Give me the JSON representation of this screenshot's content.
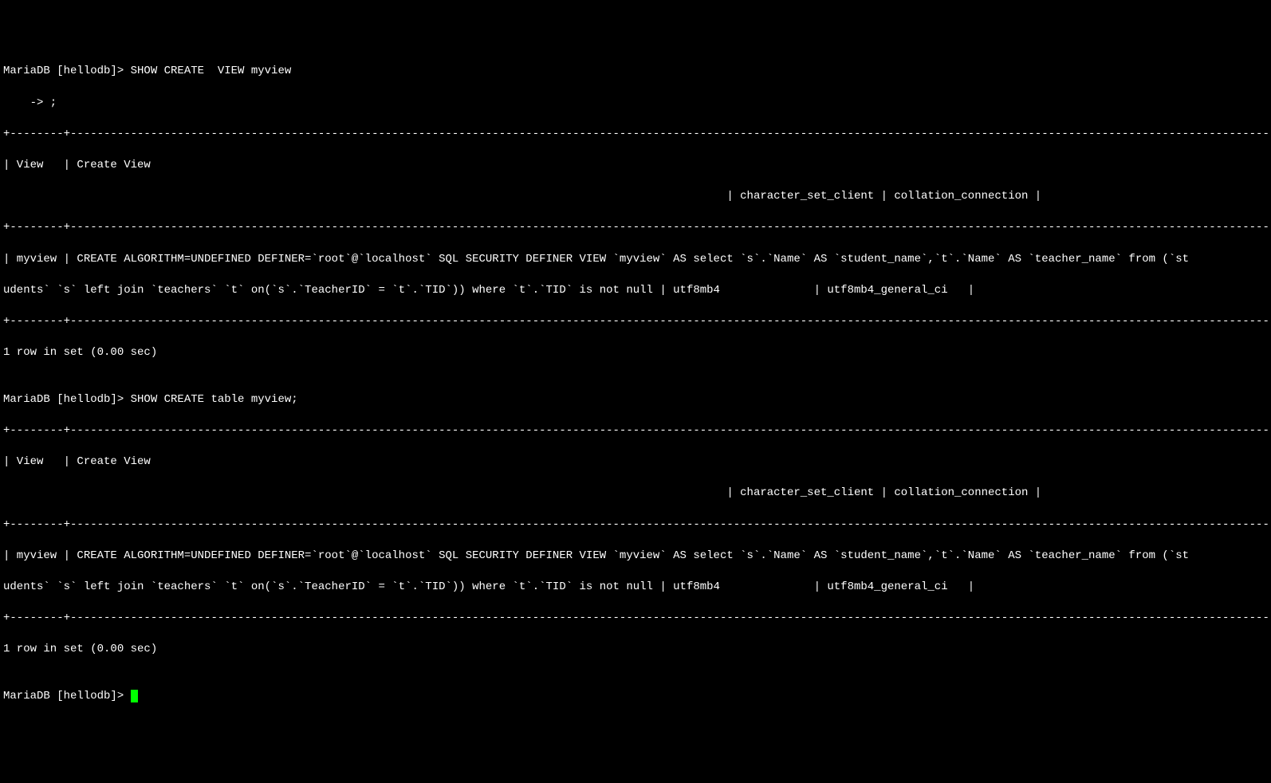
{
  "terminal": {
    "line01": "MariaDB [hellodb]> SHOW CREATE  VIEW myview",
    "line02": "    -> ;",
    "line03": "+--------+-----------------------------------------------------------------------------------------------------------------------------------------------------------------------------------------------------------------------------------------------------------+----------------------+----------------------+",
    "line04": "| View   | Create View",
    "line05": "                                                                                                            | character_set_client | collation_connection |",
    "line06": "+--------+-----------------------------------------------------------------------------------------------------------------------------------------------------------------------------------------------------------------------------------------------------------+----------------------+----------------------+",
    "line07": "| myview | CREATE ALGORITHM=UNDEFINED DEFINER=`root`@`localhost` SQL SECURITY DEFINER VIEW `myview` AS select `s`.`Name` AS `student_name`,`t`.`Name` AS `teacher_name` from (`st",
    "line08": "udents` `s` left join `teachers` `t` on(`s`.`TeacherID` = `t`.`TID`)) where `t`.`TID` is not null | utf8mb4              | utf8mb4_general_ci   |",
    "line09": "+--------+-----------------------------------------------------------------------------------------------------------------------------------------------------------------------------------------------------------------------------------------------------------+----------------------+----------------------+",
    "line10": "1 row in set (0.00 sec)",
    "line11": "",
    "line12": "MariaDB [hellodb]> SHOW CREATE table myview;",
    "line13": "+--------+-----------------------------------------------------------------------------------------------------------------------------------------------------------------------------------------------------------------------------------------------------------+----------------------+----------------------+",
    "line14": "| View   | Create View",
    "line15": "                                                                                                            | character_set_client | collation_connection |",
    "line16": "+--------+-----------------------------------------------------------------------------------------------------------------------------------------------------------------------------------------------------------------------------------------------------------+----------------------+----------------------+",
    "line17": "| myview | CREATE ALGORITHM=UNDEFINED DEFINER=`root`@`localhost` SQL SECURITY DEFINER VIEW `myview` AS select `s`.`Name` AS `student_name`,`t`.`Name` AS `teacher_name` from (`st",
    "line18": "udents` `s` left join `teachers` `t` on(`s`.`TeacherID` = `t`.`TID`)) where `t`.`TID` is not null | utf8mb4              | utf8mb4_general_ci   |",
    "line19": "+--------+-----------------------------------------------------------------------------------------------------------------------------------------------------------------------------------------------------------------------------------------------------------+----------------------+----------------------+",
    "line20": "1 row in set (0.00 sec)",
    "line21": "",
    "line22": "MariaDB [hellodb]> "
  }
}
